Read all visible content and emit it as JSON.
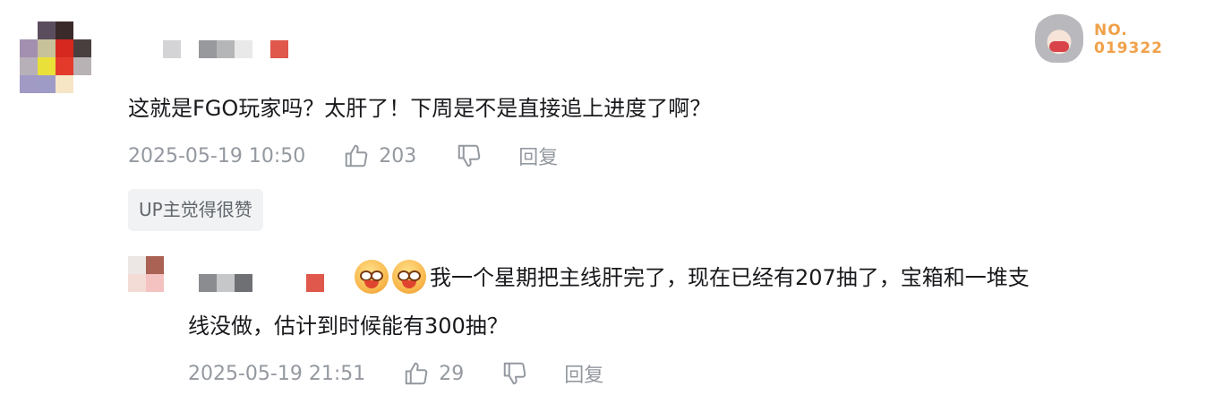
{
  "comment": {
    "text": "这就是FGO玩家吗？太肝了！下周是不是直接追上进度了啊？",
    "time": "2025-05-19 10:50",
    "likes": "203",
    "reply_label": "回复",
    "badge": "UP主觉得很赞",
    "fan_badge": {
      "line1": "NO.",
      "line2": "019322"
    }
  },
  "reply": {
    "text_line1": "我一个星期把主线肝完了，现在已经有207抽了，宝箱和一堆支",
    "text_line2": "线没做，估计到时候能有300抽？",
    "time": "2025-05-19 21:51",
    "likes": "29",
    "reply_label": "回复",
    "emoji_count": 2
  },
  "colors": {
    "text": "#18191c",
    "meta": "#9499a0",
    "badge_bg": "#f1f2f3",
    "fan_badge": "#f0a14a"
  }
}
